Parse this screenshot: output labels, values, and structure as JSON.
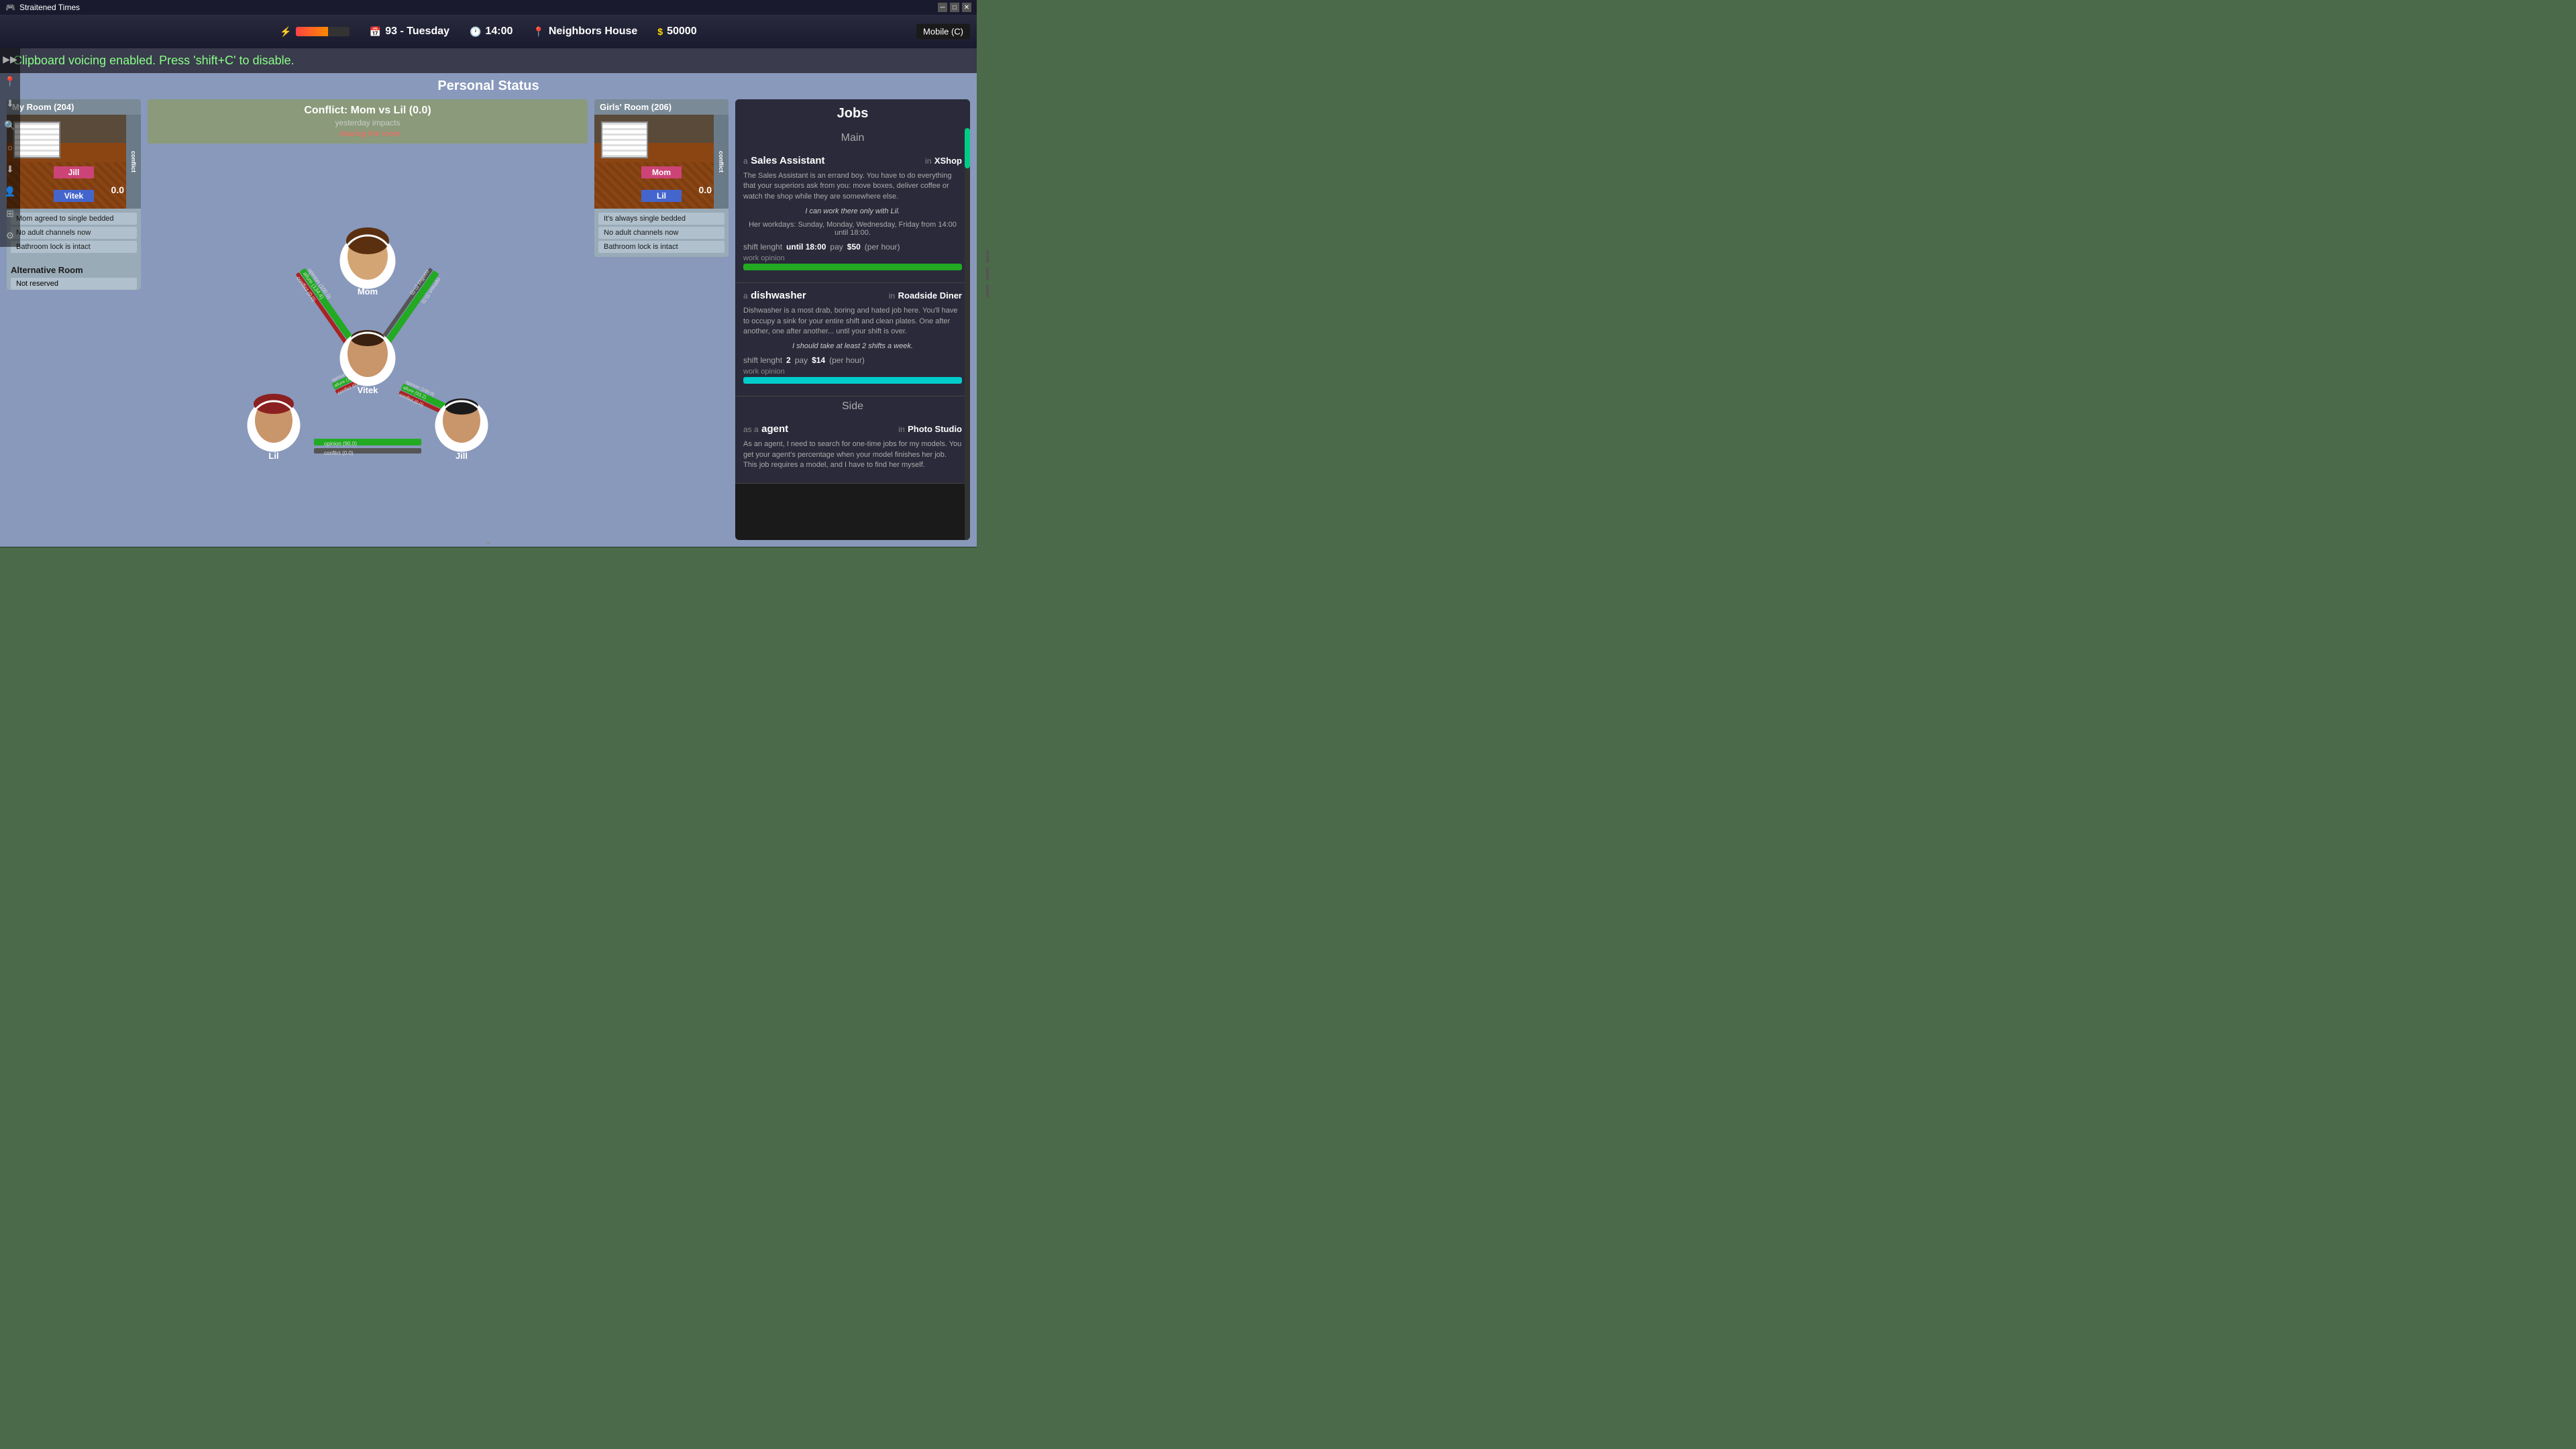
{
  "window": {
    "title": "Straitened Times",
    "controls": [
      "minimize",
      "restore",
      "close"
    ]
  },
  "topbar": {
    "energy_label": "⚡",
    "day_number": "93",
    "day_name": "Tuesday",
    "time": "14:00",
    "location": "Neighbors House",
    "money": "50000",
    "mobile_label": "Mobile (C)"
  },
  "clipboard_bar": {
    "message": "Clipboard voicing enabled. Press 'shift+C' to disable."
  },
  "personal_status": {
    "title": "Personal Status"
  },
  "my_room": {
    "header": "My Room (204)",
    "occupants": [
      "Jill",
      "Vitek"
    ],
    "conflict_value": "0.0",
    "statuses": [
      "Mom agreed to single bedded",
      "No adult channels now",
      "Bathroom lock is intact"
    ],
    "alt_room": {
      "label": "Alternative Room",
      "status": "Not reserved"
    }
  },
  "conflict_box": {
    "title": "Conflict: Mom vs Lil (0.0)",
    "subtitle": "yesterday impacts",
    "detail": "- sharing the room"
  },
  "girls_room": {
    "header": "Girls' Room (206)",
    "occupants": [
      "Mom",
      "Lil"
    ],
    "conflict_value": "0.0",
    "statuses": [
      "It's always single bedded",
      "No adult channels now",
      "Bathroom lock is intact"
    ]
  },
  "characters": {
    "mom": {
      "name": "Mom"
    },
    "vitek": {
      "name": "Vitek"
    },
    "lil": {
      "name": "Lil"
    },
    "jill": {
      "name": "Jill"
    }
  },
  "relationships": {
    "mom_vitek": {
      "opinion": 100.0,
      "allure": 134.4,
      "conflict": 0.0
    },
    "mom_lil": {
      "opinion": 100.0,
      "conflict": 0.0
    },
    "vitek_lil": {
      "opinion": 100.0,
      "allure": 105.8,
      "conflict": 0.0
    },
    "vitek_jill": {
      "opinion": 100.0,
      "allure": 93.2,
      "conflict": 0.0
    },
    "lil_jill": {
      "opinion": 90.0,
      "conflict": 0.0
    }
  },
  "jobs": {
    "title": "Jobs",
    "sections": [
      {
        "name": "Main",
        "jobs": [
          {
            "as": "a",
            "role": "Sales Assistant",
            "in": "in",
            "company": "XShop",
            "description": "The Sales Assistant is an errand boy. You have to do everything that your superiors ask from you: move boxes, deliver coffee or watch the shop while they are somewhere else.",
            "note": "I can work there only with Lil.",
            "schedule": "Her workdays: Sunday, Monday, Wednesday, Friday from 14:00 until 18:00.",
            "shift_label": "shift lenght",
            "shift_until": "until 18:00",
            "pay_label": "pay",
            "pay": "$50",
            "per": "(per hour)",
            "work_opinion_label": "work opinion",
            "work_opinion_color": "green"
          },
          {
            "as": "a",
            "role": "dishwasher",
            "in": "in",
            "company": "Roadside Diner",
            "description": "Dishwasher is a most drab, boring and hated job here. You'll have to occupy a sink for your entire shift and clean plates. One after another, one after another... until your shift is over.",
            "note": "I should take at least 2 shifts a week.",
            "shift_label": "shift lenght",
            "shift_value": "2",
            "pay_label": "pay",
            "pay": "$14",
            "per": "(per hour)",
            "work_opinion_label": "work opinion",
            "work_opinion_color": "cyan"
          }
        ]
      },
      {
        "name": "Side",
        "jobs": [
          {
            "as": "as a",
            "role": "agent",
            "in": "in",
            "company": "Photo Studio",
            "description": "As an agent, I need to search for one-time jobs for my models. You get your agent's percentage when your model finishes her job. This job requires a model, and I have to find her myself.",
            "note": "",
            "work_opinion_label": "",
            "work_opinion_color": ""
          }
        ]
      }
    ]
  }
}
